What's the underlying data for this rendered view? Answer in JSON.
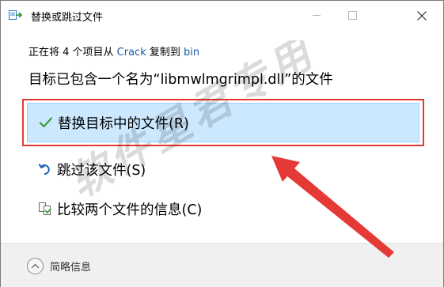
{
  "window": {
    "title": "替换或跳过文件"
  },
  "message": {
    "prefix": "正在将 4 个项目从 ",
    "source": "Crack",
    "middle": " 复制到 ",
    "destination": "bin",
    "heading": "目标已包含一个名为“libmwlmgrimpl.dll”的文件"
  },
  "options": {
    "replace": "替换目标中的文件(R)",
    "skip": "跳过该文件(S)",
    "compare": "比较两个文件的信息(C)"
  },
  "footer": {
    "details_label": "简略信息"
  },
  "watermark": {
    "text": "软件星君专用"
  },
  "colors": {
    "selected_bg": "#cce8ff",
    "selected_border": "#99d1ff",
    "link": "#1c5aa8",
    "annotation_red": "#e53935",
    "check_green": "#3a9a3a"
  },
  "icons": {
    "title": "copy-files-icon",
    "replace": "checkmark-icon",
    "skip": "skip-undo-icon",
    "compare": "compare-files-icon",
    "details": "chevron-up-icon"
  }
}
